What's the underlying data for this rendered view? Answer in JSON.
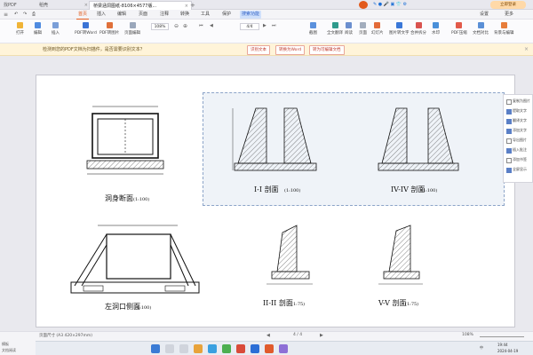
{
  "tabs": [
    {
      "label": "找PDF",
      "active": false
    },
    {
      "label": "稻壳",
      "active": false
    },
    {
      "label": "桥梁涵洞图纸-8106×4577版...",
      "active": true
    }
  ],
  "menu": {
    "items": [
      "首页",
      "插入",
      "编辑",
      "页面",
      "注释",
      "转换",
      "工具",
      "保护"
    ],
    "active": "首页",
    "accent_label": "搜索功能",
    "right": [
      "设置",
      "更多"
    ],
    "login": "立即登录"
  },
  "toolbar": {
    "buttons": [
      "打开",
      "编辑",
      "插入",
      "PDF转Word",
      "PDF转图片",
      "页面编辑",
      "截图",
      "全文翻译",
      "阅读",
      "页面",
      "幻灯片",
      "图片转文字",
      "合并拆分",
      "水印",
      "PDF压缩",
      "文档对比",
      "背景与编辑"
    ],
    "zoom": "108%",
    "page": "4/4"
  },
  "notice": {
    "message": "检测到您的PDF文档为扫描件，是否需要识别文本？",
    "buttons": [
      "识别文本",
      "转换为Word",
      "转为可编辑文档"
    ]
  },
  "drawing": {
    "section_title": "洞身断面",
    "section_scale": "(1:100)",
    "elev_title": "左洞口侧面",
    "elev_scale": "(1:100)",
    "views": [
      {
        "title": "I-I 剖面",
        "scale": "(1:100)"
      },
      {
        "title": "IV-IV 剖面",
        "scale": "(1:100)"
      },
      {
        "title": "II-II 剖面",
        "scale": "(1:75)"
      },
      {
        "title": "V-V 剖面",
        "scale": "(1:75)"
      }
    ]
  },
  "right_panel": {
    "items": [
      {
        "label": "复制为图片",
        "checked": false
      },
      {
        "label": "提取文字",
        "checked": true
      },
      {
        "label": "翻译文字",
        "checked": true
      },
      {
        "label": "添加文字",
        "checked": true
      },
      {
        "label": "导出图片",
        "checked": false
      },
      {
        "label": "插入批注",
        "checked": true
      },
      {
        "label": "添加书签",
        "checked": false
      },
      {
        "label": "全屏显示",
        "checked": true
      }
    ]
  },
  "status": {
    "page_size": "页面尺寸 (A3 420×297mm)",
    "page": "4 / 4",
    "zoom": "108%"
  },
  "left_stub": {
    "line1": "模板",
    "line2": "文档阅读"
  },
  "tray": {
    "lang": "中",
    "time": "19:44",
    "date": "2024-04-19"
  }
}
